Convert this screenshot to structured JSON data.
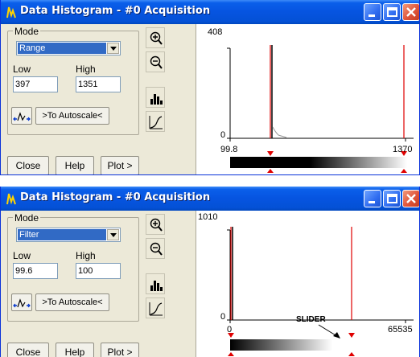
{
  "windows": [
    {
      "title": "Data Histogram - #0   Acquisition",
      "mode_legend": "Mode",
      "mode_value": "Range",
      "low_label": "Low",
      "high_label": "High",
      "low_value": "397",
      "high_value": "1351",
      "autoscale_label": ">To Autoscale<",
      "close_label": "Close",
      "help_label": "Help",
      "plot_label": "Plot >",
      "plot": {
        "ymax": "408",
        "ymin": "0",
        "xmin": "99.8",
        "xmax": "1370"
      }
    },
    {
      "title": "Data Histogram - #0   Acquisition",
      "mode_legend": "Mode",
      "mode_value": "Filter",
      "low_label": "Low",
      "high_label": "High",
      "low_value": "99.6",
      "high_value": "100",
      "autoscale_label": ">To Autoscale<",
      "close_label": "Close",
      "help_label": "Help",
      "plot_label": "Plot >",
      "plot": {
        "ymax": "1010",
        "ymin": "0",
        "xmin": "0",
        "xmax": "65535",
        "annotation": "SLIDER"
      }
    }
  ],
  "icons": [
    "app-icon",
    "minimize-icon",
    "maximize-icon",
    "close-icon",
    "zoom-in-icon",
    "zoom-out-icon",
    "histogram-icon",
    "curve-icon",
    "auto-fit-icon",
    "dropdown-arrow-icon"
  ],
  "colors": {
    "titlebar": "#0654e0",
    "accent": "#316ac5",
    "marker": "#e00000",
    "close_button": "#e0553a"
  }
}
